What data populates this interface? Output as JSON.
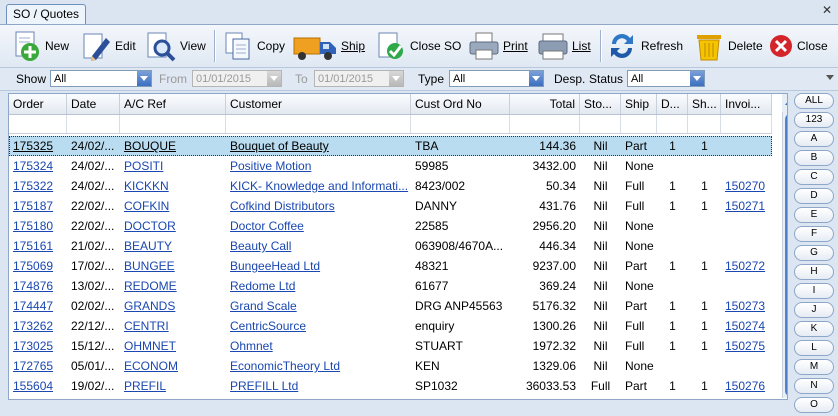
{
  "tab": {
    "title": "SO / Quotes"
  },
  "toolbar": {
    "new": "New",
    "edit": "Edit",
    "view": "View",
    "copy": "Copy",
    "ship": "Ship",
    "close_so": "Close SO",
    "print": "Print",
    "list": "List",
    "refresh": "Refresh",
    "delete": "Delete",
    "close": "Close"
  },
  "filters": {
    "show_label": "Show",
    "show_value": "All",
    "from_label": "From",
    "from_value": "01/01/2015",
    "to_label": "To",
    "to_value": "01/01/2015",
    "type_label": "Type",
    "type_value": "All",
    "desp_label": "Desp.",
    "status_label": "Status",
    "status_value": "All"
  },
  "grid": {
    "columns": [
      "Order",
      "Date",
      "A/C Ref",
      "Customer",
      "Cust Ord No",
      "Total",
      "Sto...",
      "Ship",
      "D...",
      "Sh...",
      "Invoi..."
    ],
    "rows": [
      [
        "175325",
        "24/02/...",
        "BOUQUE",
        "Bouquet of Beauty",
        "TBA",
        "144.36",
        "Nil",
        "Part",
        "1",
        "1",
        ""
      ],
      [
        "175324",
        "24/02/...",
        "POSITI",
        "Positive Motion",
        "59985",
        "3432.00",
        "Nil",
        "None",
        "",
        "",
        ""
      ],
      [
        "175322",
        "24/02/...",
        "KICKKN",
        "KICK- Knowledge and Informati...",
        "8423/002",
        "50.34",
        "Nil",
        "Full",
        "1",
        "1",
        "150270"
      ],
      [
        "175187",
        "22/02/...",
        "COFKIN",
        "Cofkind Distributors",
        "DANNY",
        "431.76",
        "Nil",
        "Full",
        "1",
        "1",
        "150271"
      ],
      [
        "175180",
        "22/02/...",
        "DOCTOR",
        "Doctor Coffee",
        "22585",
        "2956.20",
        "Nil",
        "None",
        "",
        "",
        ""
      ],
      [
        "175161",
        "21/02/...",
        "BEAUTY",
        "Beauty Call",
        "063908/4670A...",
        "446.34",
        "Nil",
        "None",
        "",
        "",
        ""
      ],
      [
        "175069",
        "17/02/...",
        "BUNGEE",
        "BungeeHead Ltd",
        "48321",
        "9237.00",
        "Nil",
        "Part",
        "1",
        "1",
        "150272"
      ],
      [
        "174876",
        "13/02/...",
        "REDOME",
        "Redome Ltd",
        "61677",
        "369.24",
        "Nil",
        "None",
        "",
        "",
        ""
      ],
      [
        "174447",
        "02/02/...",
        "GRANDS",
        "Grand Scale",
        "DRG ANP45563",
        "5176.32",
        "Nil",
        "Part",
        "1",
        "1",
        "150273"
      ],
      [
        "173262",
        "22/12/...",
        "CENTRI",
        "CentricSource",
        "enquiry",
        "1300.26",
        "Nil",
        "Full",
        "1",
        "1",
        "150274"
      ],
      [
        "173025",
        "15/12/...",
        "OHMNET",
        "Ohmnet",
        "STUART",
        "1972.32",
        "Nil",
        "Full",
        "1",
        "1",
        "150275"
      ],
      [
        "172765",
        "05/01/...",
        "ECONOM",
        "EconomicTheory Ltd",
        "KEN",
        "1329.06",
        "Nil",
        "None",
        "",
        "",
        ""
      ],
      [
        "155604",
        "19/02/...",
        "PREFIL",
        "PREFILL Ltd",
        "SP1032",
        "36033.53",
        "Full",
        "Part",
        "1",
        "1",
        "150276"
      ]
    ]
  },
  "alpha_index": [
    "ALL",
    "123",
    "A",
    "B",
    "C",
    "D",
    "E",
    "F",
    "G",
    "H",
    "I",
    "J",
    "K",
    "L",
    "M",
    "N",
    "O"
  ],
  "colors": {
    "selected_row": "#b9dcf0",
    "link": "#1a47b0",
    "accent": "#3c6fc0"
  }
}
